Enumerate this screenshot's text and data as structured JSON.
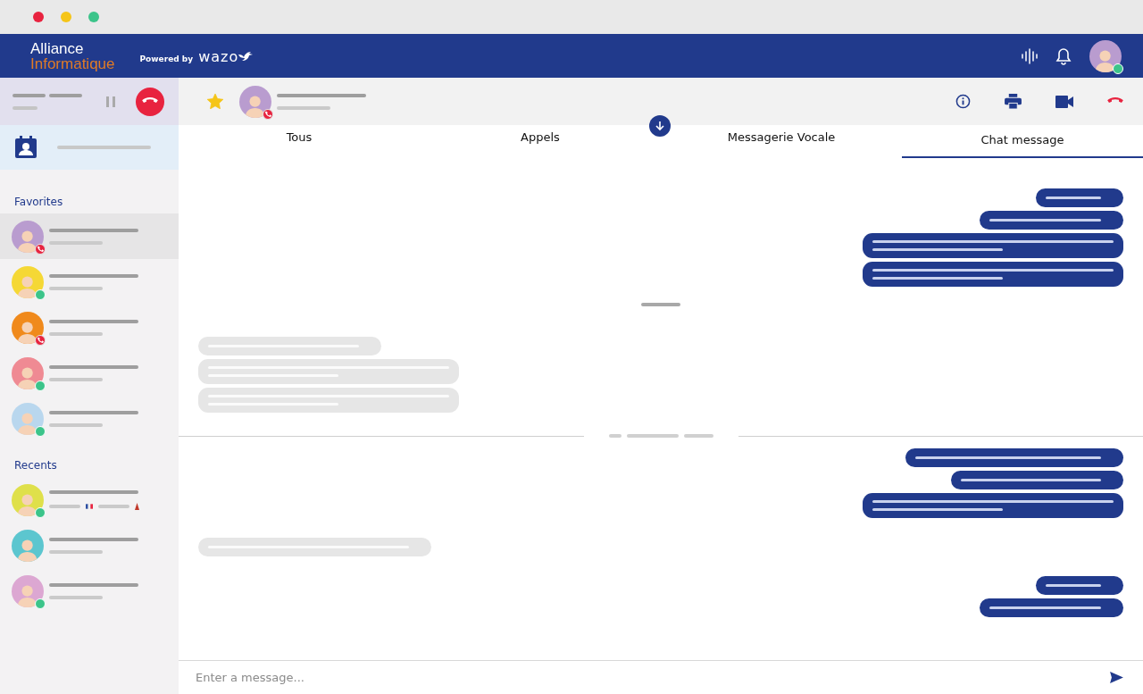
{
  "header": {
    "brand_top": "Alliance",
    "brand_bottom": "Informatique",
    "powered_by": "Powered by",
    "powered_brand": "wazo",
    "user": {
      "color": "#b99ccf",
      "online": true,
      "in_call": false
    }
  },
  "call_bar": {
    "on_hold": false
  },
  "contact_bar": {
    "favorite": true,
    "avatar": {
      "color": "#b99ccf",
      "online": false,
      "in_call": true
    }
  },
  "sidebar": {
    "favorites_title": "Favorites",
    "favorites": [
      {
        "color": "#b99ccf",
        "online": false,
        "in_call": true,
        "selected": true
      },
      {
        "color": "#f5d835",
        "online": true,
        "in_call": false,
        "selected": false
      },
      {
        "color": "#f08a1c",
        "online": false,
        "in_call": true,
        "selected": false
      },
      {
        "color": "#ef8a93",
        "online": true,
        "in_call": false,
        "selected": false
      },
      {
        "color": "#b9d7ee",
        "online": true,
        "in_call": false,
        "selected": false
      }
    ],
    "recents_title": "Recents",
    "recents": [
      {
        "color": "#dfe04a",
        "online": true,
        "in_call": false,
        "selected": false,
        "flags": true
      },
      {
        "color": "#5cc6cf",
        "online": false,
        "in_call": false,
        "selected": false,
        "flags": false
      },
      {
        "color": "#dca7d2",
        "online": true,
        "in_call": false,
        "selected": false,
        "flags": false
      }
    ]
  },
  "tabs": [
    {
      "label": "Tous",
      "selected": false
    },
    {
      "label": "Appels",
      "selected": false
    },
    {
      "label": "Messagerie Vocale",
      "selected": false
    },
    {
      "label": "Chat message",
      "selected": true
    }
  ],
  "messages": [
    {
      "kind": "out"
    },
    {
      "kind": "out"
    },
    {
      "kind": "out"
    },
    {
      "kind": "out"
    },
    {
      "kind": "marker"
    },
    {
      "kind": "in"
    },
    {
      "kind": "in"
    },
    {
      "kind": "in"
    },
    {
      "kind": "separator"
    },
    {
      "kind": "out"
    },
    {
      "kind": "out"
    },
    {
      "kind": "out"
    },
    {
      "kind": "in"
    },
    {
      "kind": "out"
    },
    {
      "kind": "out"
    }
  ],
  "composer": {
    "placeholder": "Enter a message..."
  }
}
